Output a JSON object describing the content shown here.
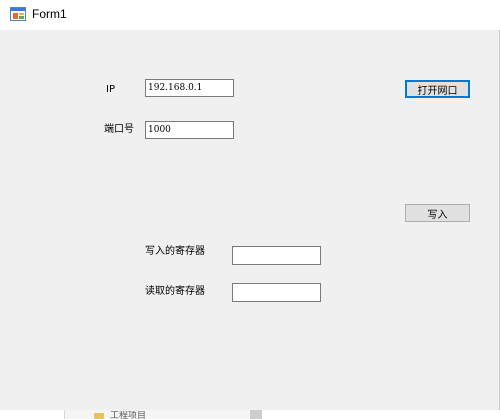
{
  "window": {
    "title": "Form1"
  },
  "form": {
    "ip_label": "IP",
    "ip_value": "192.168.0.1",
    "port_label": "端口号",
    "port_value": "1000",
    "open_button": "打开网口",
    "write_button": "写入",
    "write_register_label": "写入的寄存器",
    "write_register_value": "",
    "read_register_label": "读取的寄存器",
    "read_register_value": ""
  },
  "background": {
    "tree_item_label": "工程项目"
  },
  "colors": {
    "form_background": "#f0f0f0",
    "focus_border": "#0078d7"
  }
}
